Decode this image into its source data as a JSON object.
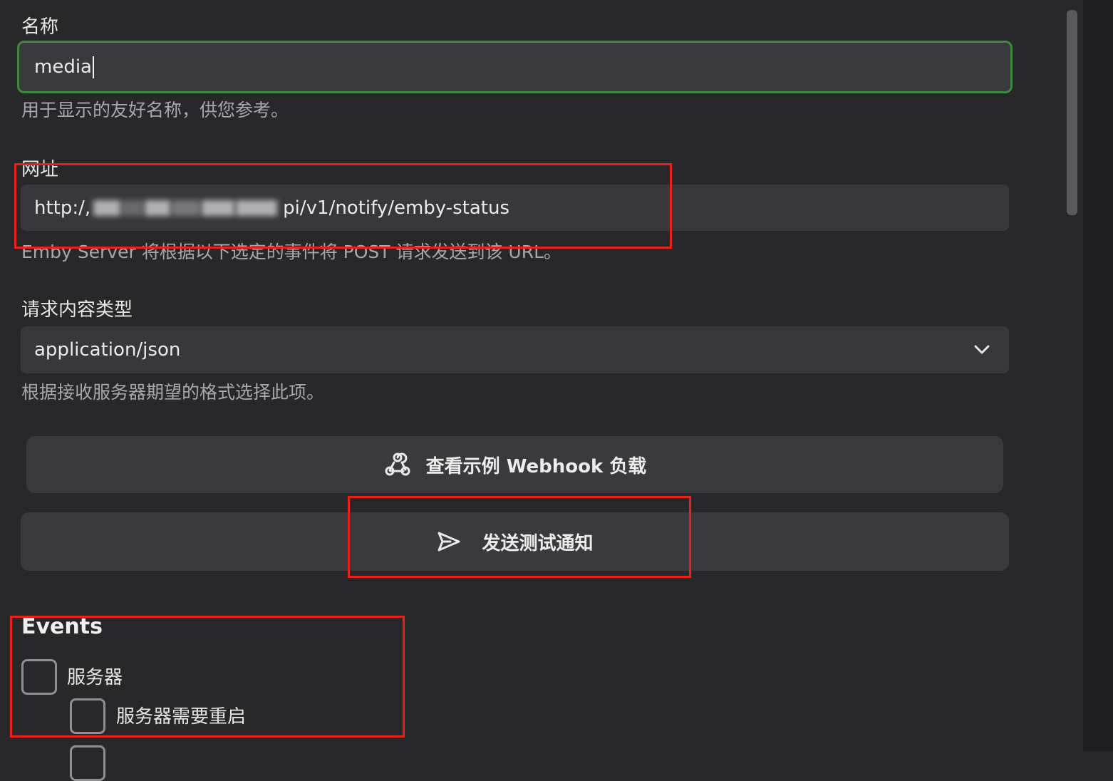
{
  "name_field": {
    "label": "名称",
    "value": "media",
    "hint": "用于显示的友好名称，供您参考。"
  },
  "url_field": {
    "label": "网址",
    "value_prefix": "http:/,",
    "value_suffix": "pi/v1/notify/emby-status",
    "hint": "Emby Server 将根据以下选定的事件将 POST 请求发送到该 URL。"
  },
  "content_type_field": {
    "label": "请求内容类型",
    "selected": "application/json",
    "hint": "根据接收服务器期望的格式选择此项。"
  },
  "buttons": {
    "view_sample": "查看示例 Webhook 负载",
    "send_test": "发送测试通知"
  },
  "events": {
    "heading": "Events",
    "items": [
      {
        "label": "服务器",
        "checked": false
      },
      {
        "label": "服务器需要重启",
        "checked": false
      }
    ]
  },
  "colors": {
    "background": "#28282b",
    "field": "#38383c",
    "focus_border": "#3f8a3c",
    "annotation_red": "#e8221b"
  },
  "icons": {
    "view_sample": "webhook-icon",
    "send_test": "send-icon",
    "select": "chevron-down-icon"
  }
}
